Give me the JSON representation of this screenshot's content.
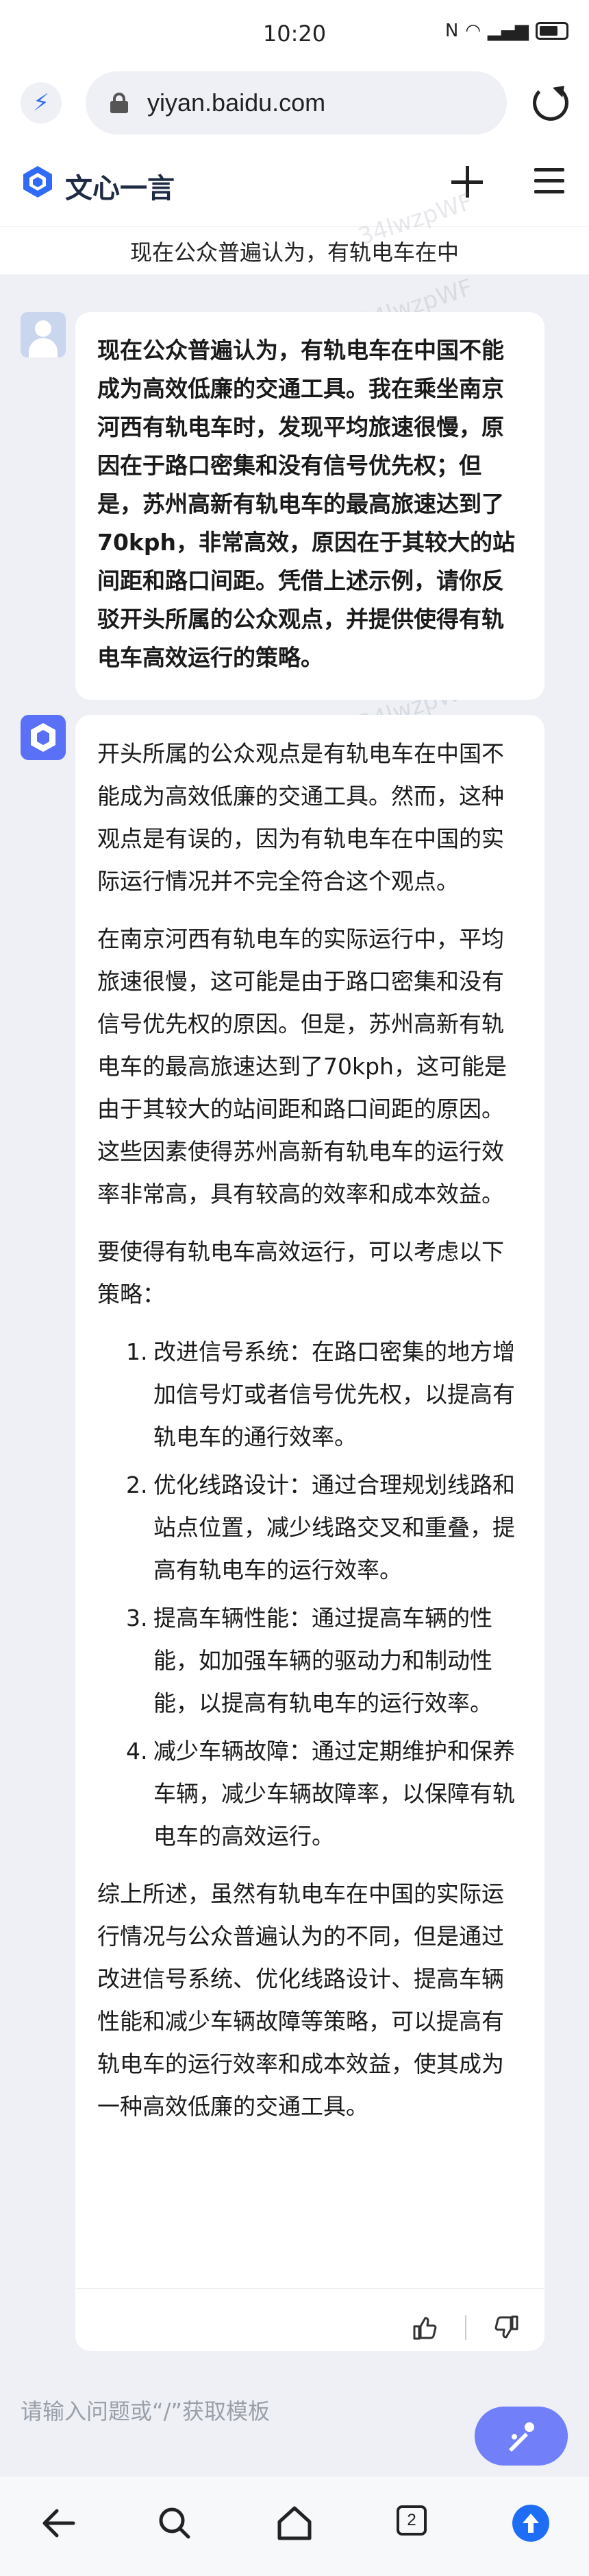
{
  "status_bar": {
    "time": "10:20",
    "battery": "57"
  },
  "browser": {
    "url": "yiyan.baidu.com"
  },
  "app": {
    "name": "文心一言",
    "question_preview": "现在公众普遍认为，有轨电车在中"
  },
  "user_message": {
    "text": "现在公众普遍认为，有轨电车在中国不能成为高效低廉的交通工具。我在乘坐南京河西有轨电车时，发现平均旅速很慢，原因在于路口密集和没有信号优先权；但是，苏州高新有轨电车的最高旅速达到了70kph，非常高效，原因在于其较大的站间距和路口间距。凭借上述示例，请你反驳开头所属的公众观点，并提供使得有轨电车高效运行的策略。"
  },
  "bot_message": {
    "paragraphs": [
      "开头所属的公众观点是有轨电车在中国不能成为高效低廉的交通工具。然而，这种观点是有误的，因为有轨电车在中国的实际运行情况并不完全符合这个观点。",
      "在南京河西有轨电车的实际运行中，平均旅速很慢，这可能是由于路口密集和没有信号优先权的原因。但是，苏州高新有轨电车的最高旅速达到了70kph，这可能是由于其较大的站间距和路口间距的原因。这些因素使得苏州高新有轨电车的运行效率非常高，具有较高的效率和成本效益。",
      "要使得有轨电车高效运行，可以考虑以下策略："
    ],
    "strategies": [
      {
        "num": "1.",
        "text": "改进信号系统：在路口密集的地方增加信号灯或者信号优先权，以提高有轨电车的通行效率。"
      },
      {
        "num": "2.",
        "text": "优化线路设计：通过合理规划线路和站点位置，减少线路交叉和重叠，提高有轨电车的运行效率。"
      },
      {
        "num": "3.",
        "text": "提高车辆性能：通过提高车辆的性能，如加强车辆的驱动力和制动性能，以提高有轨电车的运行效率。"
      },
      {
        "num": "4.",
        "text": "减少车辆故障：通过定期维护和保养车辆，减少车辆故障率，以保障有轨电车的高效运行。"
      }
    ],
    "conclusion": "综上所述，虽然有轨电车在中国的实际运行情况与公众普遍认为的不同，但是通过改进信号系统、优化线路设计、提高车辆性能和减少车辆故障等策略，可以提高有轨电车的运行效率和成本效益，使其成为一种高效低廉的交通工具。"
  },
  "input": {
    "placeholder": "请输入问题或“/”获取模板"
  },
  "nav": {
    "tab_count": "2"
  },
  "watermark": {
    "text": "34lwzpWF"
  },
  "colors": {
    "accent": "#2f6bf6",
    "background": "#eef0f5",
    "send_gradient_start": "#8e7dfc",
    "send_gradient_end": "#5e78f7"
  }
}
